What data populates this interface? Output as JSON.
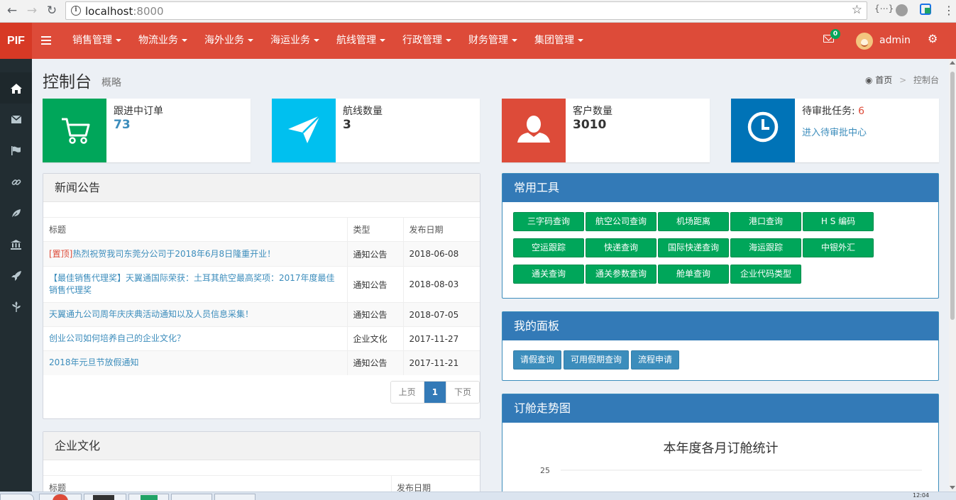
{
  "browser": {
    "url_host": "localhost",
    "url_port": ":8000"
  },
  "header": {
    "logo": "PIF",
    "menu": [
      "销售管理",
      "物流业务",
      "海外业务",
      "海运业务",
      "航线管理",
      "行政管理",
      "财务管理",
      "集团管理"
    ],
    "mail_count": "0",
    "username": "admin"
  },
  "sidebar": {
    "icons": [
      "home-icon",
      "envelope-icon",
      "flag-icon",
      "link-icon",
      "leaf-icon",
      "bank-icon",
      "rocket-icon",
      "pagelines-icon"
    ]
  },
  "page": {
    "title": "控制台",
    "subtitle": "概略",
    "breadcrumb": [
      "首页",
      "控制台"
    ]
  },
  "stats": [
    {
      "label": "跟进中订单",
      "value": "73",
      "color": "#00a65a"
    },
    {
      "label": "航线数量",
      "value": "3",
      "color": "#00c0ef"
    },
    {
      "label": "客户数量",
      "value": "3010",
      "color": "#dd4b39"
    },
    {
      "label": "待审批任务: ",
      "count": "6",
      "link": "进入待审批中心",
      "color": "#0073b7"
    }
  ],
  "news": {
    "title": "新闻公告",
    "columns": [
      "标题",
      "类型",
      "发布日期"
    ],
    "rows": [
      {
        "tag": "[置顶]",
        "title": "热烈祝贺我司东莞分公司于2018年6月8日隆重开业！",
        "type": "通知公告",
        "date": "2018-06-08"
      },
      {
        "tag": "",
        "title": "【最佳销售代理奖】天翼通国际荣获：土耳其航空最高奖项：2017年度最佳销售代理奖",
        "type": "通知公告",
        "date": "2018-08-03"
      },
      {
        "tag": "",
        "title": "天翼通九公司周年庆庆典活动通知以及人员信息采集！",
        "type": "通知公告",
        "date": "2018-07-05"
      },
      {
        "tag": "",
        "title": "创业公司如何培养自己的企业文化？",
        "type": "企业文化",
        "date": "2017-11-27"
      },
      {
        "tag": "",
        "title": "2018年元旦节放假通知",
        "type": "通知公告",
        "date": "2017-11-21"
      }
    ],
    "pager": {
      "prev": "上页",
      "current": "1",
      "next": "下页"
    }
  },
  "culture": {
    "title": "企业文化",
    "columns": [
      "标题",
      "发布日期"
    ]
  },
  "tools": {
    "title": "常用工具",
    "buttons": [
      "三字码查询",
      "航空公司查询",
      "机场距离",
      "港口查询",
      "H S 编码",
      "空运跟踪",
      "快递查询",
      "国际快递查询",
      "海运跟踪",
      "中银外汇",
      "通关查询",
      "通关参数查询",
      "舱单查询",
      "企业代码类型"
    ]
  },
  "panel": {
    "title": "我的面板",
    "buttons": [
      "请假查询",
      "可用假期查询",
      "流程申请"
    ]
  },
  "chart_box": {
    "title": "订舱走势图"
  },
  "chart_data": {
    "type": "line",
    "title": "本年度各月订舱统计",
    "y_ticks_visible": [
      "25"
    ],
    "series": []
  },
  "taskbar": {
    "clock": "12:04"
  }
}
